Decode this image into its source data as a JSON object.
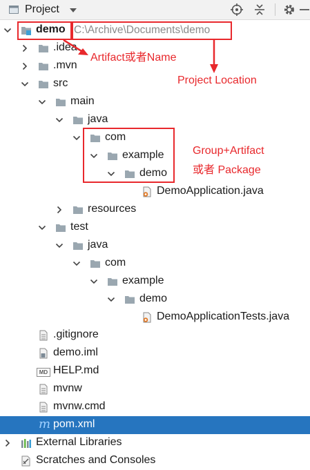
{
  "toolbar": {
    "title": "Project",
    "icons": [
      "project-icon",
      "dropdown-icon",
      "locate-icon",
      "collapse-icon",
      "gear-icon",
      "hide-icon"
    ]
  },
  "tree": {
    "root": {
      "name": "demo",
      "path": "C:\\Archive\\Documents\\demo"
    },
    "items": [
      {
        "label": ".idea"
      },
      {
        "label": ".mvn"
      },
      {
        "label": "src"
      },
      {
        "label": "main"
      },
      {
        "label": "java"
      },
      {
        "label": "com"
      },
      {
        "label": "example"
      },
      {
        "label": "demo"
      },
      {
        "label": "DemoApplication.java"
      },
      {
        "label": "resources"
      },
      {
        "label": "test"
      },
      {
        "label": "java"
      },
      {
        "label": "com"
      },
      {
        "label": "example"
      },
      {
        "label": "demo"
      },
      {
        "label": "DemoApplicationTests.java"
      },
      {
        "label": ".gitignore"
      },
      {
        "label": "demo.iml"
      },
      {
        "label": "HELP.md"
      },
      {
        "label": "mvnw"
      },
      {
        "label": "mvnw.cmd"
      },
      {
        "label": "pom.xml"
      },
      {
        "label": "External Libraries"
      },
      {
        "label": "Scratches and Consoles"
      }
    ],
    "md_badge": "MD",
    "maven_glyph": "m"
  },
  "annotations": {
    "artifact": "Artifact或者Name",
    "project_location": "Project Location",
    "group_line1": "Group+Artifact",
    "group_line2": "或者 Package"
  },
  "colors": {
    "selection": "#2675bf",
    "annotation": "#e8282c",
    "folder": "#9aa7b0",
    "module": "#3b9fd6"
  }
}
